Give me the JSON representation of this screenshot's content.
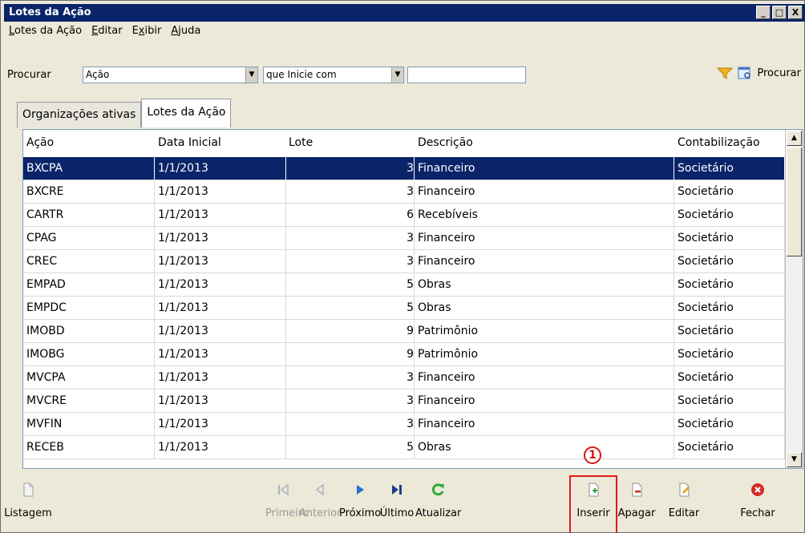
{
  "window": {
    "title": "Lotes da Ação"
  },
  "window_buttons": {
    "minimize": "_",
    "maximize": "□",
    "close": "X"
  },
  "menubar": [
    {
      "label": "Lotes da Ação",
      "accel": "L",
      "rest": "otes da Ação"
    },
    {
      "label": "Editar",
      "accel": "E",
      "rest": "ditar"
    },
    {
      "label": "Exibir",
      "pre": "E",
      "accel": "x",
      "rest": "ibir"
    },
    {
      "label": "Ajuda",
      "accel": "A",
      "rest": "juda"
    }
  ],
  "search": {
    "label": "Procurar",
    "field_value": "Ação",
    "operator_value": "que Inicie com",
    "text_value": "",
    "button_label": "Procurar"
  },
  "tabs": [
    {
      "label": "Organizações ativas",
      "active": false
    },
    {
      "label": "Lotes da Ação",
      "active": true
    }
  ],
  "table": {
    "columns": [
      "Ação",
      "Data Inicial",
      "Lote",
      "Descrição",
      "Contabilização"
    ],
    "rows": [
      [
        "BXCPA",
        "1/1/2013",
        "3",
        "Financeiro",
        "Societário"
      ],
      [
        "BXCRE",
        "1/1/2013",
        "3",
        "Financeiro",
        "Societário"
      ],
      [
        "CARTR",
        "1/1/2013",
        "6",
        "Recebíveis",
        "Societário"
      ],
      [
        "CPAG",
        "1/1/2013",
        "3",
        "Financeiro",
        "Societário"
      ],
      [
        "CREC",
        "1/1/2013",
        "3",
        "Financeiro",
        "Societário"
      ],
      [
        "EMPAD",
        "1/1/2013",
        "5",
        "Obras",
        "Societário"
      ],
      [
        "EMPDC",
        "1/1/2013",
        "5",
        "Obras",
        "Societário"
      ],
      [
        "IMOBD",
        "1/1/2013",
        "9",
        "Patrimônio",
        "Societário"
      ],
      [
        "IMOBG",
        "1/1/2013",
        "9",
        "Patrimônio",
        "Societário"
      ],
      [
        "MVCPA",
        "1/1/2013",
        "3",
        "Financeiro",
        "Societário"
      ],
      [
        "MVCRE",
        "1/1/2013",
        "3",
        "Financeiro",
        "Societário"
      ],
      [
        "MVFIN",
        "1/1/2013",
        "3",
        "Financeiro",
        "Societário"
      ],
      [
        "RECEB",
        "1/1/2013",
        "5",
        "Obras",
        "Societário"
      ]
    ],
    "selected_row": 0
  },
  "toolbar": [
    {
      "label": "Listagem",
      "icon": "document-icon",
      "enabled": true
    },
    {
      "label": "Primeiro",
      "icon": "first-icon",
      "enabled": false
    },
    {
      "label": "Anterior",
      "icon": "previous-icon",
      "enabled": false
    },
    {
      "label": "Próximo",
      "icon": "next-icon",
      "enabled": true
    },
    {
      "label": "Último",
      "icon": "last-icon",
      "enabled": true
    },
    {
      "label": "Atualizar",
      "icon": "refresh-icon",
      "enabled": true
    },
    {
      "label": "Inserir",
      "icon": "insert-icon",
      "enabled": true,
      "highlighted": true
    },
    {
      "label": "Apagar",
      "icon": "delete-icon",
      "enabled": true
    },
    {
      "label": "Editar",
      "icon": "edit-icon",
      "enabled": true
    },
    {
      "label": "Fechar",
      "icon": "close-icon",
      "enabled": true
    }
  ],
  "annotation": {
    "badge": "1"
  },
  "colors": {
    "selection": "#0a246a",
    "title_bar": "#0a246a",
    "highlight": "#e01a1a"
  }
}
